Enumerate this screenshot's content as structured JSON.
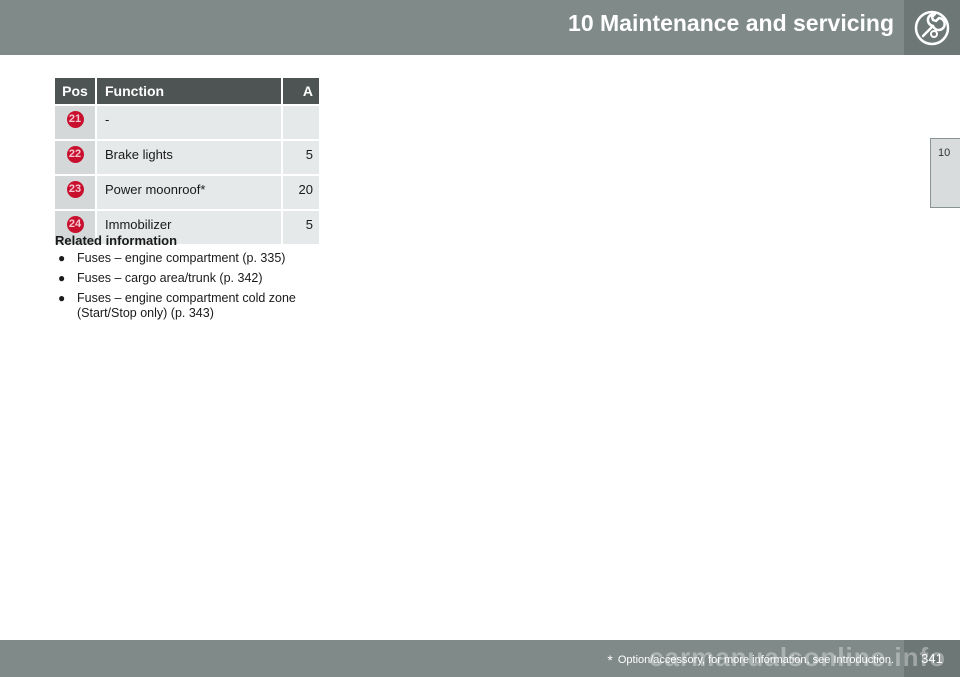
{
  "header": {
    "title": "10 Maintenance and servicing",
    "icon": "wrench-icon"
  },
  "chapter_tab": "10",
  "table": {
    "headers": {
      "pos": "Pos",
      "function": "Function",
      "a": "A"
    },
    "rows": [
      {
        "pos": "21",
        "function": "-",
        "a": ""
      },
      {
        "pos": "22",
        "function": "Brake lights",
        "a": "5"
      },
      {
        "pos": "23",
        "function": "Power moonroof*",
        "a": "20"
      },
      {
        "pos": "24",
        "function": "Immobilizer",
        "a": "5"
      }
    ]
  },
  "related": {
    "heading": "Related information",
    "items": [
      {
        "line1": "Fuses – engine compartment (p. 335)",
        "line2": ""
      },
      {
        "line1": "Fuses – cargo area/trunk (p. 342)",
        "line2": ""
      },
      {
        "line1": "Fuses – engine compartment cold zone",
        "line2": "(Start/Stop only) (p. 343)"
      }
    ]
  },
  "footer": {
    "star": "*",
    "note": "Option/accessory, for more information, see Introduction.",
    "page": "341"
  },
  "watermark": "carmanualsonline.info",
  "colors": {
    "header_bg": "#7f8a89",
    "table_header_bg": "#4d5453",
    "badge_red": "#c8102e"
  }
}
